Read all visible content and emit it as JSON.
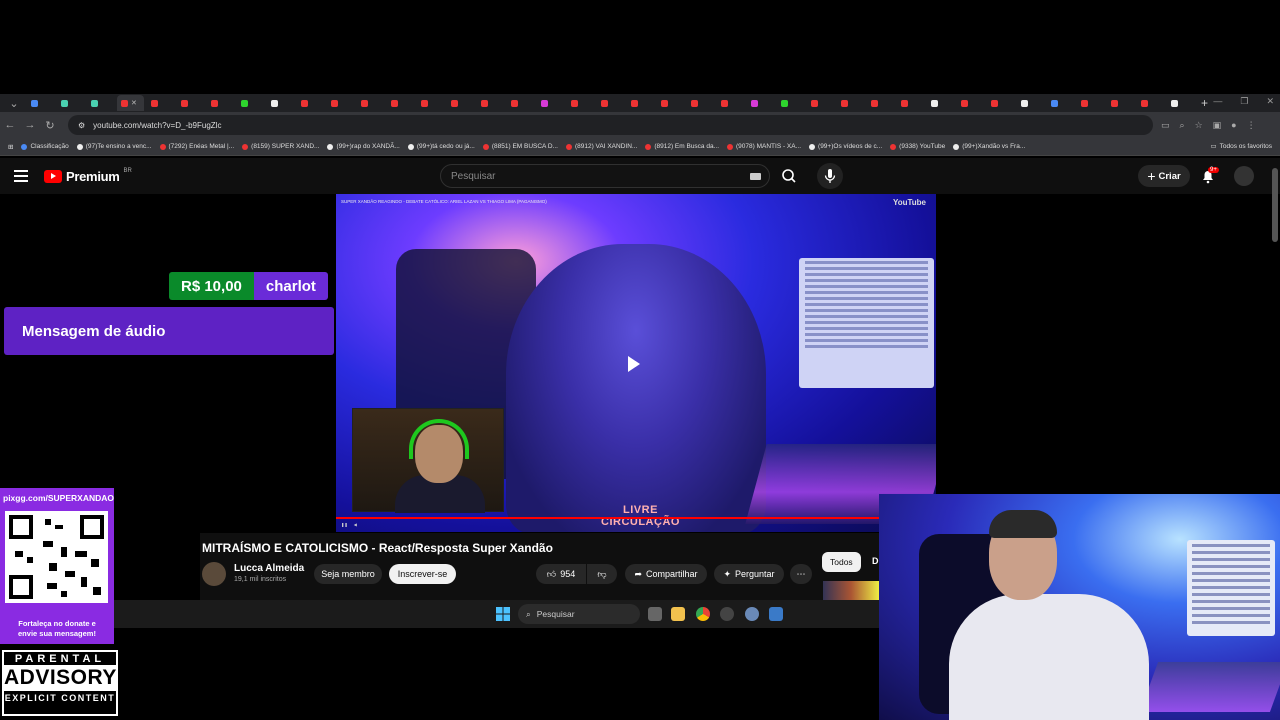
{
  "browser": {
    "url": "youtube.com/watch?v=D_-b9FugZlc",
    "bookmarks": [
      "Classificação",
      "(97)Te ensino a venc...",
      "(7292) Enéas Metal |...",
      "(8159) SUPER XAND...",
      "(99+)rap do XANDÃ...",
      "(99+)tá cedo ou já...",
      "(8851) EM BUSCA D...",
      "(8912) VAI XANDIN...",
      "(8912) Em Busca da...",
      "(9078) MANTIS - XA...",
      "(99+)Os vídeos de c...",
      "(9338) YouTube",
      "(99+)Xandão vs Fra..."
    ],
    "bookmarks_all": "Todos os favoritos"
  },
  "youtube": {
    "logo_text": "Premium",
    "logo_region": "BR",
    "search_placeholder": "Pesquisar",
    "create_label": "Criar",
    "notif_badge": "9+"
  },
  "video": {
    "overlay_title": "SUPER XANDÃO REAGINDO - DEBATE CATÓLICO: ARIEL LAZAN VS THIAGO LIMA (PAGANISMO)",
    "overlay_logo": "YouTube",
    "watermark_line1": "LIVRE",
    "watermark_line2": "CIRCULAÇÃO",
    "title": "MITRAÍSMO E CATOLICISMO - React/Resposta Super Xandão",
    "channel": "Lucca Almeida",
    "subscribers": "19,1 mil inscritos",
    "member_label": "Seja membro",
    "subscribe_label": "Inscrever-se",
    "likes": "954",
    "share_label": "Compartilhar",
    "ask_label": "Perguntar",
    "chip_all": "Todos",
    "chip_next": "D"
  },
  "overlay": {
    "donation_amount": "R$ 10,00",
    "donation_name": "charlot",
    "audio_message": "Mensagem de áudio",
    "pix_url": "pixgg.com/SUPERXANDAO",
    "pix_msg_line1": "Fortaleça no donate e",
    "pix_msg_line2": "envie sua mensagem!",
    "advisory_line1": "PARENTAL",
    "advisory_line2": "ADVISORY",
    "advisory_line3": "EXPLICIT CONTENT"
  },
  "taskbar": {
    "search_placeholder": "Pesquisar"
  },
  "colors": {
    "youtube_red": "#ff0000",
    "donation_green": "#0a8a2a",
    "donation_purple": "#6a2bd8",
    "audio_purple": "#5e22c4",
    "pix_purple": "#8a2be2"
  }
}
